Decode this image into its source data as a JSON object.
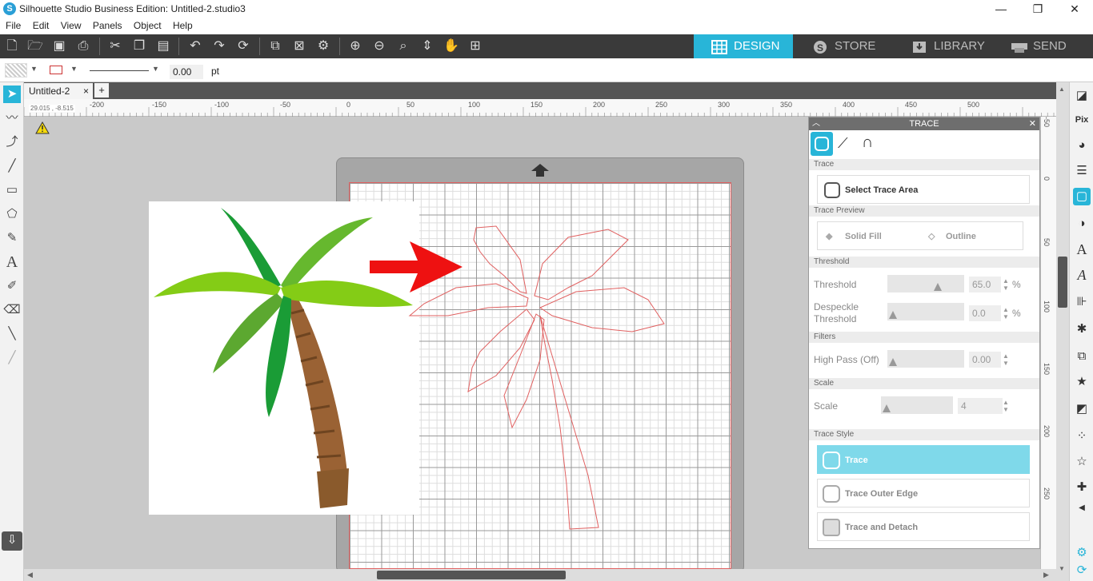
{
  "window": {
    "title": "Silhouette Studio Business Edition: Untitled-2.studio3",
    "minimize": "—",
    "maximize": "❐",
    "close": "✕"
  },
  "menu": [
    "File",
    "Edit",
    "View",
    "Panels",
    "Object",
    "Help"
  ],
  "nav_tabs": [
    {
      "label": "DESIGN",
      "icon": "grid-icon"
    },
    {
      "label": "STORE",
      "icon": "store-icon"
    },
    {
      "label": "LIBRARY",
      "icon": "library-icon"
    },
    {
      "label": "SEND",
      "icon": "send-icon"
    }
  ],
  "properties": {
    "line_width": "0.00",
    "unit": "pt"
  },
  "document_tab": {
    "label": "Untitled-2",
    "close": "×",
    "add": "+"
  },
  "coordinates": "29.015 , -8.515",
  "ruler": {
    "h_labels": [
      "-200",
      "-150",
      "-100",
      "-50",
      "0",
      "50",
      "100",
      "150",
      "200",
      "250",
      "300",
      "350",
      "400",
      "450",
      "500"
    ],
    "v_labels": [
      "-50",
      "0",
      "50",
      "100",
      "150",
      "200",
      "250"
    ]
  },
  "trace_panel": {
    "title": "TRACE",
    "section_trace": "Trace",
    "select_trace_area": "Select Trace Area",
    "section_preview": "Trace Preview",
    "solid_fill": "Solid Fill",
    "outline": "Outline",
    "section_threshold": "Threshold",
    "threshold_label": "Threshold",
    "threshold_value": "65.0",
    "threshold_unit": "%",
    "despeckle_label_1": "Despeckle",
    "despeckle_label_2": "Threshold",
    "despeckle_value": "0.0",
    "despeckle_unit": "%",
    "section_filters": "Filters",
    "highpass_label": "High Pass (Off)",
    "highpass_value": "0.00",
    "section_scale": "Scale",
    "scale_label": "Scale",
    "scale_value": "4",
    "section_style": "Trace Style",
    "style_trace": "Trace",
    "style_outer": "Trace Outer Edge",
    "style_detach": "Trace and Detach",
    "accent": "#7fd9ea"
  },
  "colors": {
    "accent": "#28b5d8",
    "toolbar": "#3a3a3a",
    "trace_line": "#e06060"
  }
}
